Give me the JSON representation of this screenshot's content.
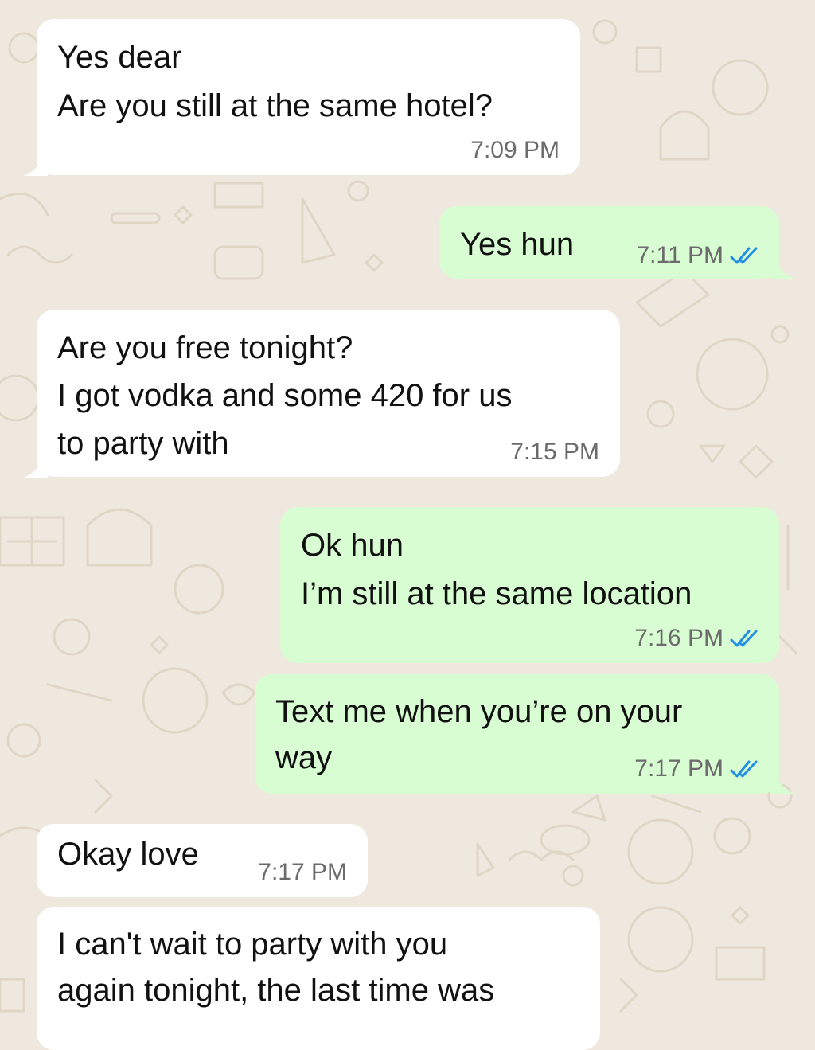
{
  "chat": {
    "messages": [
      {
        "direction": "incoming",
        "text": "Yes dear\nAre you still at the same hotel?",
        "time": "7:09 PM"
      },
      {
        "direction": "outgoing",
        "text": "Yes hun",
        "time": "7:11 PM",
        "read_icon": "double-check-icon"
      },
      {
        "direction": "incoming",
        "text": "Are you free tonight?\nI got vodka and some 420 for us\nto party with",
        "time": "7:15 PM"
      },
      {
        "direction": "outgoing",
        "text": "Ok hun\nI’m still at the same location",
        "time": "7:16 PM",
        "read_icon": "double-check-icon"
      },
      {
        "direction": "outgoing",
        "text": "Text me when you’re on your\nway",
        "time": "7:17 PM",
        "read_icon": "double-check-icon"
      },
      {
        "direction": "incoming",
        "text": "Okay love",
        "time": "7:17 PM"
      },
      {
        "direction": "incoming",
        "text": "I can't wait to party with you\nagain tonight, the last time was",
        "time": ""
      }
    ]
  },
  "colors": {
    "background": "#efe8de",
    "incoming_bubble": "#ffffff",
    "outgoing_bubble": "#d9fdd3",
    "read_tick": "#1f8ee5",
    "meta_text": "#6b6b6b"
  }
}
